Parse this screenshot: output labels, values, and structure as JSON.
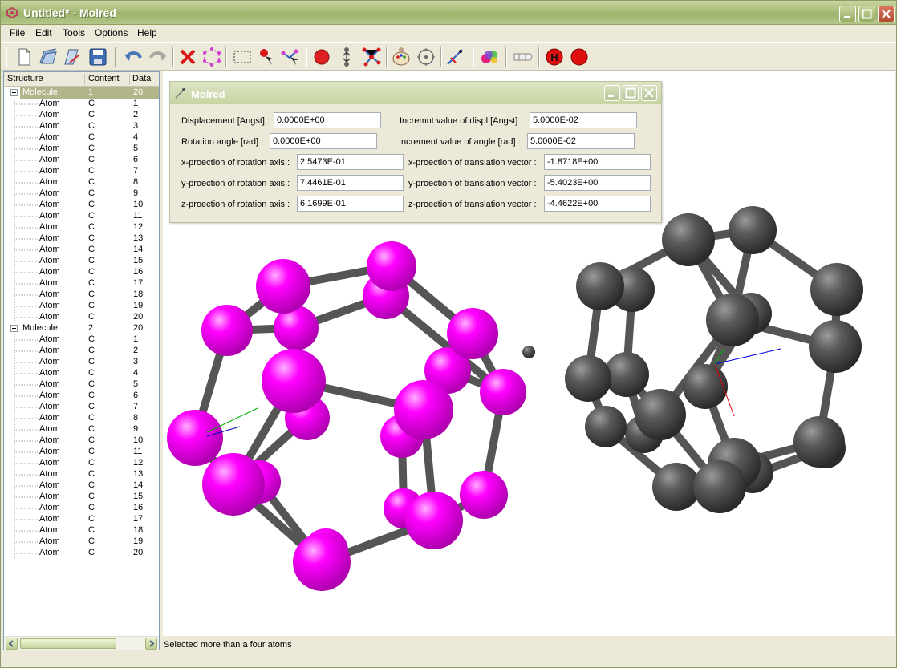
{
  "window": {
    "title": "Untitled* - Molred"
  },
  "menu": [
    "File",
    "Edit",
    "Tools",
    "Options",
    "Help"
  ],
  "toolbar": [
    "new-file-icon",
    "open-file-icon",
    "open-folder-icon",
    "save-icon",
    "undo-icon",
    "redo-icon",
    "delete-icon",
    "select-all-icon",
    "rect-select-icon",
    "pick-atom-icon",
    "pick-bond-icon",
    "add-atom-icon",
    "move-atom-icon",
    "molecule-icon",
    "palette-icon",
    "rotate-icon",
    "measure-icon",
    "colors-icon",
    "bond-length-icon",
    "hydrogen-icon",
    "stop-icon"
  ],
  "tree": {
    "headers": [
      "Structure",
      "Content",
      "Data"
    ],
    "molecules": [
      {
        "label": "Molecule",
        "content": "1",
        "data": "20",
        "atoms": [
          {
            "label": "Atom",
            "content": "C",
            "data": "1"
          },
          {
            "label": "Atom",
            "content": "C",
            "data": "2"
          },
          {
            "label": "Atom",
            "content": "C",
            "data": "3"
          },
          {
            "label": "Atom",
            "content": "C",
            "data": "4"
          },
          {
            "label": "Atom",
            "content": "C",
            "data": "5"
          },
          {
            "label": "Atom",
            "content": "C",
            "data": "6"
          },
          {
            "label": "Atom",
            "content": "C",
            "data": "7"
          },
          {
            "label": "Atom",
            "content": "C",
            "data": "8"
          },
          {
            "label": "Atom",
            "content": "C",
            "data": "9"
          },
          {
            "label": "Atom",
            "content": "C",
            "data": "10"
          },
          {
            "label": "Atom",
            "content": "C",
            "data": "11"
          },
          {
            "label": "Atom",
            "content": "C",
            "data": "12"
          },
          {
            "label": "Atom",
            "content": "C",
            "data": "13"
          },
          {
            "label": "Atom",
            "content": "C",
            "data": "14"
          },
          {
            "label": "Atom",
            "content": "C",
            "data": "15"
          },
          {
            "label": "Atom",
            "content": "C",
            "data": "16"
          },
          {
            "label": "Atom",
            "content": "C",
            "data": "17"
          },
          {
            "label": "Atom",
            "content": "C",
            "data": "18"
          },
          {
            "label": "Atom",
            "content": "C",
            "data": "19"
          },
          {
            "label": "Atom",
            "content": "C",
            "data": "20"
          }
        ]
      },
      {
        "label": "Molecule",
        "content": "2",
        "data": "20",
        "atoms": [
          {
            "label": "Atom",
            "content": "C",
            "data": "1"
          },
          {
            "label": "Atom",
            "content": "C",
            "data": "2"
          },
          {
            "label": "Atom",
            "content": "C",
            "data": "3"
          },
          {
            "label": "Atom",
            "content": "C",
            "data": "4"
          },
          {
            "label": "Atom",
            "content": "C",
            "data": "5"
          },
          {
            "label": "Atom",
            "content": "C",
            "data": "6"
          },
          {
            "label": "Atom",
            "content": "C",
            "data": "7"
          },
          {
            "label": "Atom",
            "content": "C",
            "data": "8"
          },
          {
            "label": "Atom",
            "content": "C",
            "data": "9"
          },
          {
            "label": "Atom",
            "content": "C",
            "data": "10"
          },
          {
            "label": "Atom",
            "content": "C",
            "data": "11"
          },
          {
            "label": "Atom",
            "content": "C",
            "data": "12"
          },
          {
            "label": "Atom",
            "content": "C",
            "data": "13"
          },
          {
            "label": "Atom",
            "content": "C",
            "data": "14"
          },
          {
            "label": "Atom",
            "content": "C",
            "data": "15"
          },
          {
            "label": "Atom",
            "content": "C",
            "data": "16"
          },
          {
            "label": "Atom",
            "content": "C",
            "data": "17"
          },
          {
            "label": "Atom",
            "content": "C",
            "data": "18"
          },
          {
            "label": "Atom",
            "content": "C",
            "data": "19"
          },
          {
            "label": "Atom",
            "content": "C",
            "data": "20"
          }
        ]
      }
    ]
  },
  "dialog": {
    "title": "Molred",
    "displacement_label": "Displacement [Angst] :",
    "displacement_value": "0.0000E+00",
    "incr_displ_label": "Incremnt value of displ.[Angst] :",
    "incr_displ_value": "5.0000E-02",
    "rotation_label": "Rotation angle [rad] :",
    "rotation_value": "0.0000E+00",
    "incr_angle_label": "Increment value of angle [rad] :",
    "incr_angle_value": "5.0000E-02",
    "x_rot_label": "x-proection of rotation axis :",
    "x_rot_value": "2.5473E-01",
    "y_rot_label": "y-proection of rotation axis :",
    "y_rot_value": "7.4461E-01",
    "z_rot_label": "z-proection of rotation axis :",
    "z_rot_value": "6.1699E-01",
    "x_tr_label": "x-proection of translation vector :",
    "x_tr_value": "-1.8718E+00",
    "y_tr_label": "y-proection of translation vector :",
    "y_tr_value": "-5.4023E+00",
    "z_tr_label": "z-proection of translation vector :",
    "z_tr_value": "-4.4622E+00"
  },
  "status": "Selected more than a four atoms",
  "colors": {
    "selected_atom": "#ff00ff",
    "atom": "#555555",
    "bond": "#555555",
    "accent_title": "#a8bc78"
  }
}
